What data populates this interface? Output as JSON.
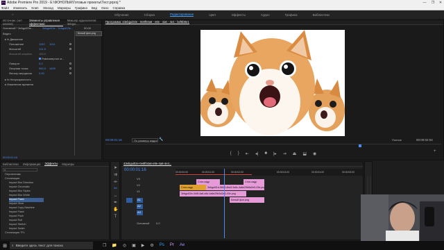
{
  "app": {
    "title": "Adobe Premiere Pro 2019 - E:\\ФОНОЛЫК\\Готовые проекты\\Тест.prproj *",
    "icon_text": "Pr"
  },
  "window_controls": [
    "—",
    "❐",
    "✕"
  ],
  "menu": [
    "Файл",
    "Изменить",
    "Клип",
    "Эпизод",
    "Маркеры",
    "Графика",
    "Вид",
    "Окно",
    "Справка"
  ],
  "workspaces": [
    "Обучение",
    "Сборка",
    "Редактирование",
    "Цвет",
    "Эффекты",
    "Аудио",
    "Графика",
    "Библиотеки"
  ],
  "active_workspace": "Редактирование",
  "effect_controls": {
    "tabs": [
      "Источник: (нет клипов)",
      "Элементы управления эффектами",
      "Микшер аудиоклипов: 3ebgui..."
    ],
    "source_label": "Основной * 3ebgui03e...",
    "clip_label": "3ebgui03e - 3ebgui03e...",
    "timecode_head": "00:00",
    "clip_chip": "Белый фон.png",
    "section_video": "Видео",
    "rows": [
      {
        "label": "Движение",
        "value1": "",
        "value2": ""
      },
      {
        "label": "Положение",
        "value1": "1152",
        "value2": "1011"
      },
      {
        "label": "Масштаб",
        "value1": "131.5",
        "value2": ""
      },
      {
        "label": "Масштаб ширины",
        "value1": "100.0",
        "value2": ""
      },
      {
        "label": "",
        "value1": "Равномерное м...",
        "value2": ""
      },
      {
        "label": "Поворот",
        "value1": "0.0",
        "value2": ""
      },
      {
        "label": "Опорная точка",
        "value1": "960.0",
        "value2": "1409"
      },
      {
        "label": "Фильтр мерцания",
        "value1": "0.00",
        "value2": ""
      },
      {
        "label": "Непрозрачность",
        "value1": "",
        "value2": ""
      },
      {
        "label": "Изменение времени",
        "value1": "",
        "value2": ""
      }
    ],
    "bottom_timecode": "00:00:01:16"
  },
  "program": {
    "tab": "Программа: 43ebgui02e - 0e8f04a6 - e8e - 4a6 - 4e4 - bef6b9e1",
    "timecode_left": "00:00:01:16",
    "fit_label": "По размеру кадра",
    "quality": "Полное",
    "timecode_right": "00:00:02:04"
  },
  "project": {
    "tabs": [
      "Библиотеки",
      "Информация",
      "Эффекты",
      "Маркеры"
    ],
    "active_tab": "Эффекты",
    "items": [
      "Перспектива",
      "Стилизация",
      "Impact Blur Direction",
      "Impact Chromatic",
      "Impact Blur Styles",
      "Impact Blur White",
      "Impact Flash",
      "Impact Glow",
      "Impact Copy Machine",
      "Impact Flash",
      "Impact Push",
      "Impact Roll",
      "Impact Stretch",
      "Impact Swish",
      "Стилизация TFL"
    ],
    "selected_index": 6
  },
  "timeline": {
    "tab": "43ebgui02e-0e8f04a6-e8e-4a6-4e4...",
    "timecode": "00:00:01:16",
    "ruler_labels": [
      "00:00:00:00",
      "00:00:01:00",
      "00:00:02:00",
      "00:00:03:00",
      "00:00:04:00",
      "00:00:05:00"
    ],
    "tracks": [
      "V3",
      "V2",
      "V1",
      "A1",
      "A2",
      "A3"
    ],
    "master": "Основной",
    "master_value": "0.0",
    "clips": [
      {
        "label": "Стоп-кадр",
        "track": 0,
        "color": "#e69ad8"
      },
      {
        "label": "Стоп-кадр",
        "track": 0,
        "color": "#e69ad8"
      },
      {
        "label": "3ebgui01d-5848-4ba3-9c6c-4a6e29b8a2e5-03e.png",
        "track": 1,
        "color": "#e69ad8"
      },
      {
        "label": "Стоп-кадр",
        "track": 1,
        "color": "#e0a030"
      },
      {
        "label": "3ebgui02e-0e8f-4a6-e8e-4a6e29b3d2a6-03e.png",
        "track": 2,
        "color": "#e69ad8"
      },
      {
        "label": "Белый фон.png",
        "track": 2,
        "color": "#e69ad8"
      }
    ]
  },
  "taskbar": {
    "search_placeholder": "Введите здесь текст для поиска"
  },
  "colors": {
    "accent": "#4b8cf0",
    "clip_pink": "#e69ad8",
    "clip_orange": "#e0a030",
    "playhead": "#4b8cf0"
  },
  "icons": [
    "search-icon",
    "windows-icon",
    "home-icon",
    "play-icon",
    "stop-icon",
    "selection-tool-icon",
    "razor-tool-icon",
    "hand-tool-icon",
    "text-tool-icon",
    "pen-tool-icon",
    "wrench-icon"
  ]
}
